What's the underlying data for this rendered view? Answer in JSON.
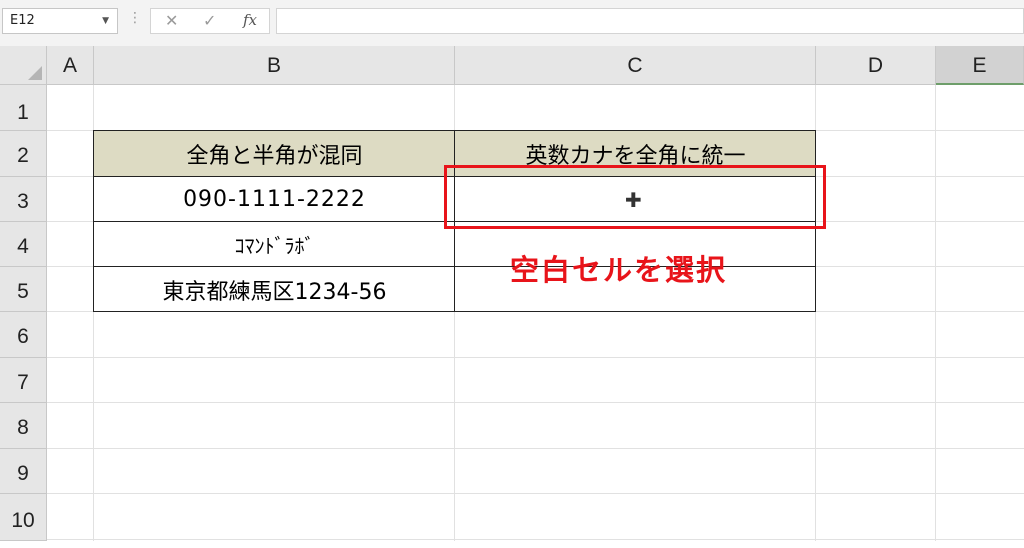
{
  "formula_bar": {
    "name_box": "E12",
    "cancel_icon": "✕",
    "enter_icon": "✓",
    "fx_label": "fx",
    "formula": ""
  },
  "columns": [
    "A",
    "B",
    "C",
    "D",
    "E"
  ],
  "selected_column": "E",
  "rows": [
    "1",
    "2",
    "3",
    "4",
    "5",
    "6",
    "7",
    "8",
    "9",
    "10"
  ],
  "table": {
    "headers": [
      "全角と半角が混同",
      "英数カナを全角に統一"
    ],
    "rows": [
      [
        "090-1111-2222",
        ""
      ],
      [
        "ｺﾏﾝﾄﾞﾗﾎﾞ",
        ""
      ],
      [
        "東京都練馬区1234-56",
        ""
      ]
    ]
  },
  "annotation": "空白セルを選択",
  "colors": {
    "header_fill": "#dddbc3",
    "highlight": "#e8141a"
  }
}
